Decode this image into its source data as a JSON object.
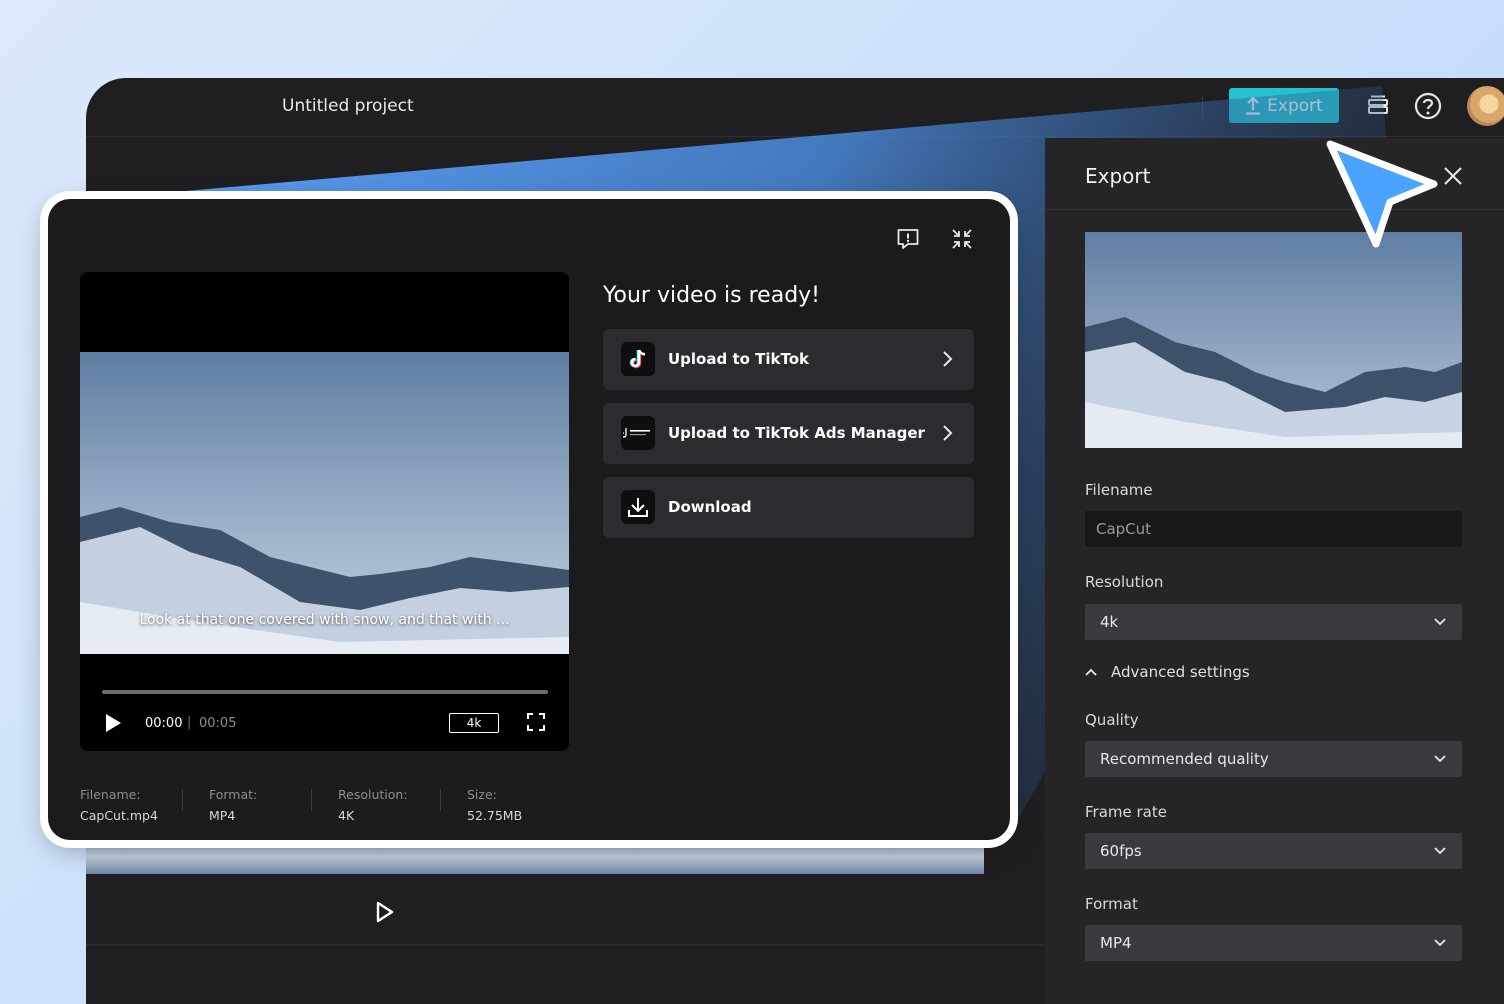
{
  "header": {
    "project_title": "Untitled project",
    "export_label": "Export",
    "icons": [
      "upload-icon",
      "layers-icon",
      "help-icon"
    ]
  },
  "export_panel": {
    "title": "Export",
    "filename_label": "Filename",
    "filename_value": "CapCut",
    "resolution_label": "Resolution",
    "resolution_value": "4k",
    "advanced_label": "Advanced settings",
    "quality_label": "Quality",
    "quality_value": "Recommended quality",
    "framerate_label": "Frame rate",
    "framerate_value": "60fps",
    "format_label": "Format",
    "format_value": "MP4"
  },
  "modal": {
    "title": "Your video is ready!",
    "subtitle": "Look at that one covered with snow, and that with ...",
    "player": {
      "current_time": "00:00",
      "separator": "|",
      "duration": "00:05",
      "quality_badge": "4k"
    },
    "actions": [
      {
        "label": "Upload to TikTok",
        "icon": "tiktok-icon",
        "has_arrow": true
      },
      {
        "label": "Upload to TikTok Ads Manager",
        "icon": "tiktok-business-icon",
        "has_arrow": true
      },
      {
        "label": "Download",
        "icon": "download-icon",
        "has_arrow": false
      }
    ],
    "meta": [
      {
        "key": "Filename:",
        "value": "CapCut.mp4"
      },
      {
        "key": "Format:",
        "value": "MP4"
      },
      {
        "key": "Resolution:",
        "value": "4K"
      },
      {
        "key": "Size:",
        "value": "52.75MB"
      }
    ]
  },
  "colors": {
    "accent": "#23c2cc",
    "cursor": "#4aa3ff",
    "background": "#1f1f22"
  }
}
